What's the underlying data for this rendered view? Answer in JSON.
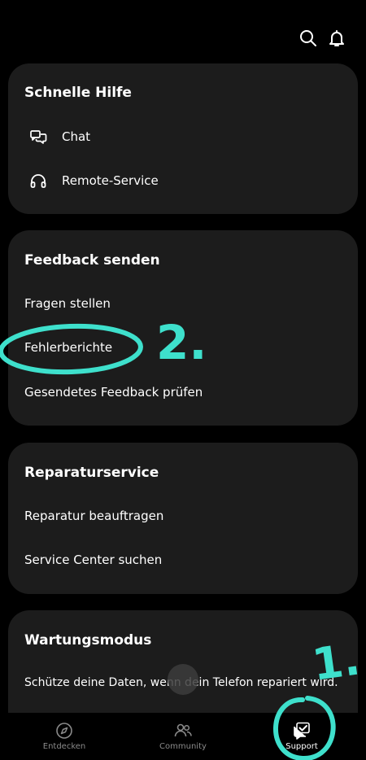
{
  "colors": {
    "background": "#000000",
    "card": "#1c1c1c",
    "annotation": "#3ee0cc",
    "muted": "#8a8a8a"
  },
  "topbar": {
    "icons": [
      "search-icon",
      "bell-icon"
    ]
  },
  "quick_help": {
    "title": "Schnelle Hilfe",
    "items": [
      {
        "label": "Chat",
        "icon": "chat-icon"
      },
      {
        "label": "Remote-Service",
        "icon": "headset-icon"
      }
    ]
  },
  "feedback": {
    "title": "Feedback senden",
    "items": [
      {
        "label": "Fragen stellen"
      },
      {
        "label": "Fehlerberichte"
      },
      {
        "label": "Gesendetes Feedback prüfen"
      }
    ]
  },
  "repair": {
    "title": "Reparaturservice",
    "items": [
      {
        "label": "Reparatur beauftragen"
      },
      {
        "label": "Service Center suchen"
      }
    ]
  },
  "maintenance": {
    "title": "Wartungsmodus",
    "description": "Schütze deine Daten, wenn dein Telefon repariert wird."
  },
  "nav": {
    "items": [
      {
        "label": "Entdecken",
        "icon": "compass-icon",
        "active": false
      },
      {
        "label": "Community",
        "icon": "people-icon",
        "active": false
      },
      {
        "label": "Support",
        "icon": "support-icon",
        "active": true
      }
    ]
  },
  "annotations": {
    "step1": "1.",
    "step2": "2."
  }
}
